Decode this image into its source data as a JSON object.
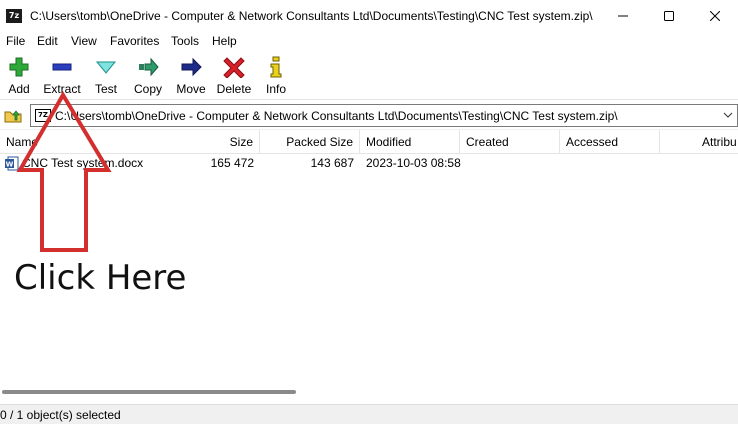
{
  "window": {
    "title": "C:\\Users\\tomb\\OneDrive - Computer & Network Consultants Ltd\\Documents\\Testing\\CNC Test system.zip\\",
    "app_icon_text": "7z"
  },
  "menu": [
    "File",
    "Edit",
    "View",
    "Favorites",
    "Tools",
    "Help"
  ],
  "toolbar": {
    "add": "Add",
    "extract": "Extract",
    "test": "Test",
    "copy": "Copy",
    "move": "Move",
    "delete": "Delete",
    "info": "Info"
  },
  "address": {
    "path": "C:\\Users\\tomb\\OneDrive - Computer & Network Consultants Ltd\\Documents\\Testing\\CNC Test system.zip\\",
    "icon_text": "7Z"
  },
  "columns": [
    "Name",
    "Size",
    "Packed Size",
    "Modified",
    "Created",
    "Accessed",
    "Attribu"
  ],
  "files": [
    {
      "name": "CNC Test system.docx",
      "size": "165 472",
      "packed": "143 687",
      "modified": "2023-10-03 08:58",
      "created": "",
      "accessed": "",
      "attributes": ""
    }
  ],
  "status": "0 / 1 object(s) selected",
  "annotation": {
    "text": "Click Here",
    "arrow_color": "#d32f2f"
  },
  "icons": {
    "add": "plus-icon",
    "extract": "minus-icon",
    "test": "check-icon",
    "copy": "copy-arrow-icon",
    "move": "move-arrow-icon",
    "delete": "x-icon",
    "info": "info-icon"
  }
}
